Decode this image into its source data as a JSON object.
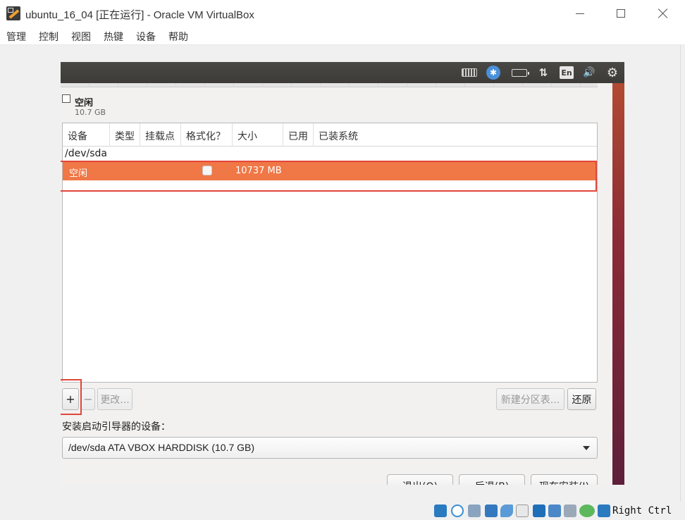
{
  "window": {
    "title": "ubuntu_16_04 [正在运行] - Oracle VM VirtualBox"
  },
  "menu": {
    "items": [
      "管理",
      "控制",
      "视图",
      "热键",
      "设备",
      "帮助"
    ]
  },
  "guest_topbar": {
    "language_indicator": "En",
    "icons": [
      "keyboard-icon",
      "accessibility-icon",
      "battery-icon",
      "network-icon",
      "language-icon",
      "volume-icon",
      "gear-icon"
    ]
  },
  "partition_bar": {
    "label": "空闲",
    "size": "10.7 GB"
  },
  "partition_table": {
    "columns": [
      "设备",
      "类型",
      "挂载点",
      "格式化？",
      "大小",
      "已用",
      "已装系统"
    ],
    "group": "/dev/sda",
    "selected_row": {
      "device": "空闲",
      "type": "",
      "mount_point": "",
      "format": false,
      "size": "10737 MB",
      "used": "",
      "system": ""
    }
  },
  "buttons": {
    "add": "+",
    "remove": "−",
    "change": "更改...",
    "new_table": "新建分区表...",
    "revert": "还原"
  },
  "boot_loader": {
    "label": "安装启动引导器的设备：",
    "value": "/dev/sda ATA VBOX HARDDISK (10.7 GB)"
  },
  "bottom_buttons": {
    "quit": "退出(Q)",
    "back": "后退(B)",
    "install": "现在安装(I)"
  },
  "statusbar": {
    "host_key": "Right Ctrl"
  },
  "colors": {
    "selection": "#f07746",
    "highlight_box": "#e2463a",
    "guest_topbar": "#3c3b37"
  }
}
